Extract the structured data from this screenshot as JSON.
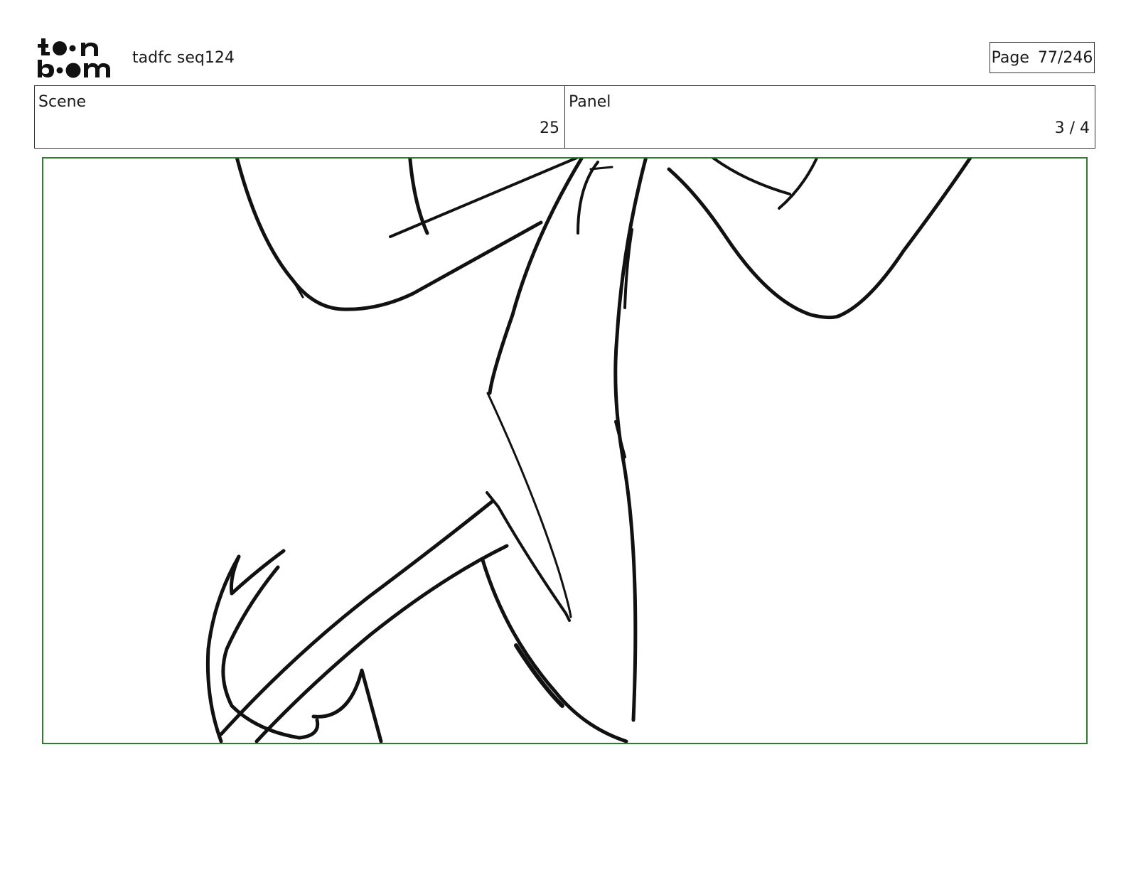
{
  "header": {
    "logo_text": "toon boom",
    "project_title": "tadfc seq124",
    "page_label": "Page",
    "page_number": "77/246"
  },
  "info": {
    "scene_label": "Scene",
    "scene_value": "25",
    "panel_label": "Panel",
    "panel_value": "3 / 4"
  },
  "colors": {
    "frame_border": "#2e7d2e",
    "sketch_stroke": "#111111"
  }
}
